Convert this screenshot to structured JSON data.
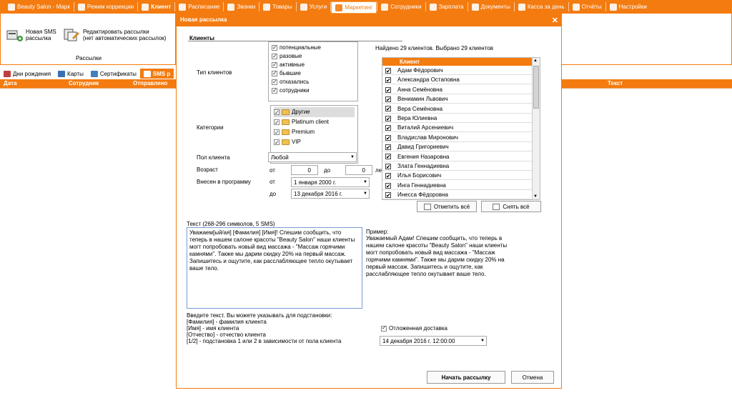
{
  "topbar": {
    "items": [
      {
        "label": "Beauty Salon - Марк",
        "icon": "salon-logo-icon"
      },
      {
        "label": "Режим коррекции",
        "icon": "correction-icon"
      },
      {
        "label": "Клиент",
        "icon": "client-icon",
        "bold": true
      },
      {
        "label": "Расписание",
        "icon": "calendar-icon"
      },
      {
        "label": "Звонки",
        "icon": "phone-icon"
      },
      {
        "label": "Товары",
        "icon": "goods-icon"
      },
      {
        "label": "Услуги",
        "icon": "services-icon"
      },
      {
        "label": "Маркетинг",
        "icon": "marketing-icon",
        "active": true
      },
      {
        "label": "Сотрудники",
        "icon": "staff-icon"
      },
      {
        "label": "Зарплата",
        "icon": "salary-icon"
      },
      {
        "label": "Документы",
        "icon": "documents-icon"
      },
      {
        "label": "Касса за день",
        "icon": "cash-icon"
      },
      {
        "label": "Отчёты",
        "icon": "reports-icon"
      },
      {
        "label": "Настройки",
        "icon": "settings-icon"
      }
    ]
  },
  "ribbon": {
    "new_sms": "Новая SMS\nрассылка",
    "edit": "Редактировать рассылки\n(нет автоматических рассылок)",
    "group_label": "Рассылки"
  },
  "subtabs": [
    {
      "label": "Дни рождения"
    },
    {
      "label": "Карты"
    },
    {
      "label": "Сертификаты"
    },
    {
      "label": "SMS р",
      "active": true
    }
  ],
  "grid": {
    "columns": [
      "Дата",
      "Сотрудник",
      "Отправлено",
      "Текст"
    ]
  },
  "dialog": {
    "title": "Новая рассылка",
    "section": "Клиенты",
    "client_type_label": "Тип клиентов",
    "client_types": [
      {
        "label": "потенциальные",
        "checked": true
      },
      {
        "label": "разовые",
        "checked": true
      },
      {
        "label": "активные",
        "checked": true
      },
      {
        "label": "бывшие",
        "checked": true
      },
      {
        "label": "отказались",
        "checked": true
      },
      {
        "label": "сотрудники",
        "checked": true
      }
    ],
    "categories_label": "Категории",
    "categories": [
      {
        "label": "Другие",
        "checked": true
      },
      {
        "label": "Platinum client",
        "checked": true
      },
      {
        "label": "Premium",
        "checked": true
      },
      {
        "label": "VIP",
        "checked": true
      }
    ],
    "gender_label": "Пол клиента",
    "gender_value": "Любой",
    "age_label": "Возраст",
    "from": "от",
    "to": "до",
    "age_from": "0",
    "age_to": "0",
    "age_unit": "ле",
    "added_label": "Внесен в программу",
    "date_from": "1 января  2000 г.",
    "date_to": "13 декабря  2016 г.",
    "found_text": "Найдено 29 клиентов. Выбрано 29 клиентов",
    "client_header": "Клиент",
    "clients": [
      "Адам Фёдорович",
      "Александра Остаповна",
      "Анна Семёновна",
      "Вениамин Львович",
      "Вера Семёновна",
      "Вера Юлиевна",
      "Виталий Арсениевич",
      "Владислав Миронович",
      "Давид Григориевич",
      "Евгения Назаровна",
      "Злата Геннадиевна",
      "Илья Борисович",
      "Инга Геннадиевна",
      "Инесса Фёдоровна"
    ],
    "select_all": "Отметить всё",
    "deselect_all": "Снять всё",
    "text_label": "Текст (268-296 символов, 5 SMS)",
    "message": "Уважаем[ый/ая] [Фамилия] [Имя]! Спешим сообщить, что теперь в нашем салоне красоты \"Beauty Salon\" наши клиенты могт попробовать новый вид массажа - \"Массаж горячими камнями\". Также мы дарим скидку 20% на первый массаж. Запишитесь и ощутите, как расслабляющее тепло окутывает ваше тело.",
    "example_label": "Пример:",
    "example": "Уважаемый  Адам! Спешим сообщить, что теперь в нашем салоне красоты \"Beauty Salon\" наши клиенты могт попробовать новый вид массажа - \"Массаж горячими камнями\". Также мы дарим скидку 20% на первый массаж. Запишитесь и ощутите, как расслабляющее тепло окутывает ваше тело.",
    "hints": [
      "Введите текст. Вы можете указывать для подстановки:",
      "[Фамилия] - фамилия клиента",
      "[Имя] - имя клиента",
      "[Отчество] - отчество клиента",
      "[1/2] - подстановка 1 или 2 в зависимости от пола клиента"
    ],
    "delayed_label": "Отложенная доставка",
    "delayed_checked": true,
    "delayed_value": "14 декабря  2016 г. 12:00:00",
    "start_button": "Начать рассылку",
    "cancel_button": "Отмена"
  }
}
